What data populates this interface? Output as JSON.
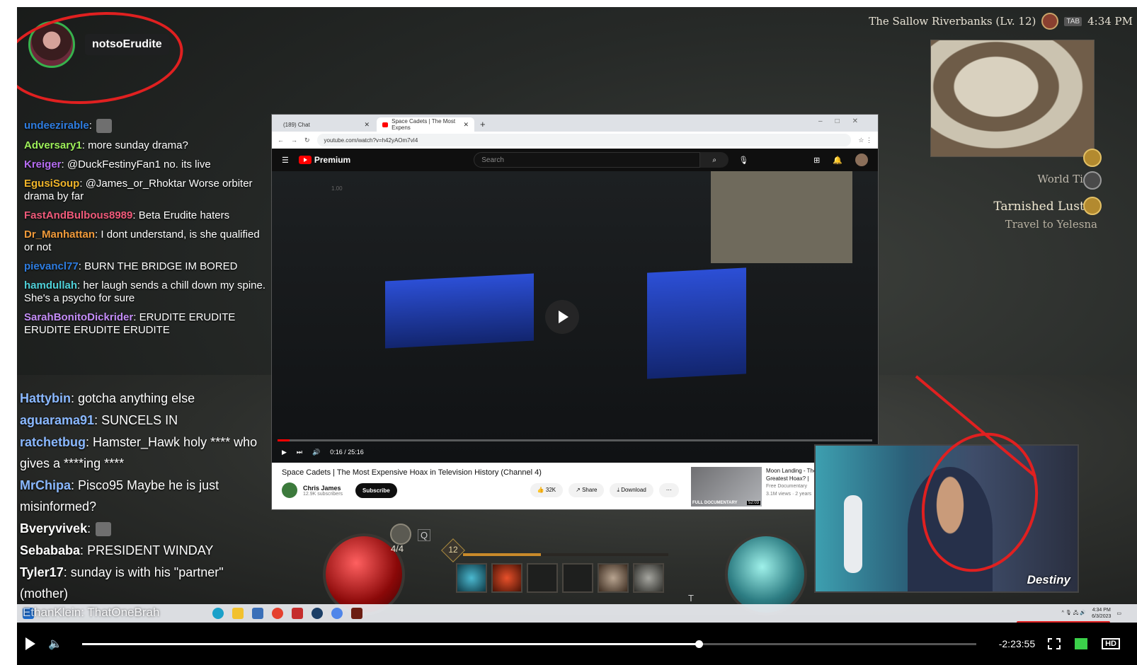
{
  "streamer": {
    "name": "notsoErudite"
  },
  "chat": [
    {
      "user": "undeezirable",
      "color": "#2e7de1",
      "text": ""
    },
    {
      "user": "Adversary1",
      "color": "#9ef05a",
      "text": "more sunday drama?"
    },
    {
      "user": "Kreiger",
      "color": "#b56cf2",
      "text": "@DuckFestinyFan1 no. its live"
    },
    {
      "user": "EgusiSoup",
      "color": "#f0b429",
      "text": "@James_or_Rhoktar Worse orbiter drama by far"
    },
    {
      "user": "FastAndBulbous8989",
      "color": "#f05a7a",
      "text": "Beta Erudite haters"
    },
    {
      "user": "Dr_Manhattan",
      "color": "#f09a3a",
      "text": "I dont understand, is she qualified or not"
    },
    {
      "user": "pievancl77",
      "color": "#2e7de1",
      "text": "BURN THE BRIDGE IM BORED"
    },
    {
      "user": "hamdullah",
      "color": "#4fd0d8",
      "text": "her laugh sends a chill down my spine. She's a psycho for sure"
    },
    {
      "user": "SarahBonitoDickrider",
      "color": "#c48df7",
      "text": "ERUDITE ERUDITE ERUDITE ERUDITE ERUDITE"
    }
  ],
  "chat2": [
    {
      "user": "Hattybin",
      "color": "#8ab8ff",
      "text": "gotcha anything else"
    },
    {
      "user": "aguarama91",
      "color": "#8ab8ff",
      "text": "SUNCELS IN"
    },
    {
      "user": "ratchetbug",
      "color": "#8ab8ff",
      "text": "Hamster_Hawk holy **** who gives a ****ing ****"
    },
    {
      "user": "MrChipa",
      "color": "#8ab8ff",
      "text": "Pisco95 Maybe he is just misinformed?"
    },
    {
      "user": "Bveryvivek",
      "color": "#ffffff",
      "text": ""
    },
    {
      "user": "Sebababa",
      "color": "#ffffff",
      "text": "PRESIDENT WINDAY"
    },
    {
      "user": "Tyler17",
      "color": "#ffffff",
      "text": "sunday is with his \"partner\" (mother)"
    }
  ],
  "chat_overlay_name": "EthanKlein: ThatOneBrah",
  "hud": {
    "zone": "The Sallow Riverbanks (Lv. 12)",
    "tab_key": "TAB",
    "time": "4:34 PM",
    "world_tier": "World Tier",
    "quest_title": "Tarnished Luster",
    "quest_sub": "Travel to Yelesna",
    "potion_count": "4/4",
    "level": "12",
    "skill_key_t": "T",
    "skill_key_q": "Q"
  },
  "browser": {
    "tab1": "(189) Chat",
    "tab2": "Space Cadets | The Most Expens",
    "url": "youtube.com/watch?v=h42yAOm7vI4",
    "logo": "Premium",
    "search_placeholder": "Search",
    "video_time": "0:16 / 25:16",
    "video_title": "Space Cadets | The Most Expensive Hoax in Television History (Channel 4)",
    "channel": "Chris James",
    "subs": "12.9K subscribers",
    "subscribe": "Subscribe",
    "likes": "32K",
    "share": "Share",
    "download": "Download",
    "rec_title": "Moon Landing - The Greatest Hoax? |",
    "rec_channel": "Free Documentary",
    "rec_meta": "3.1M views · 2 years",
    "rec_duration": "52:03",
    "rec_badge": "FULL DOCUMENTARY",
    "watermark": "1.00"
  },
  "webcam": {
    "logo": "Destiny"
  },
  "tray": {
    "time": "4:34 PM",
    "date": "6/3/2023"
  },
  "player": {
    "remaining": "-2:23:55",
    "progress": 0.69,
    "hd": "HD"
  },
  "colors": {
    "annotation": "#e02020",
    "accent_green": "#3bd14a"
  }
}
